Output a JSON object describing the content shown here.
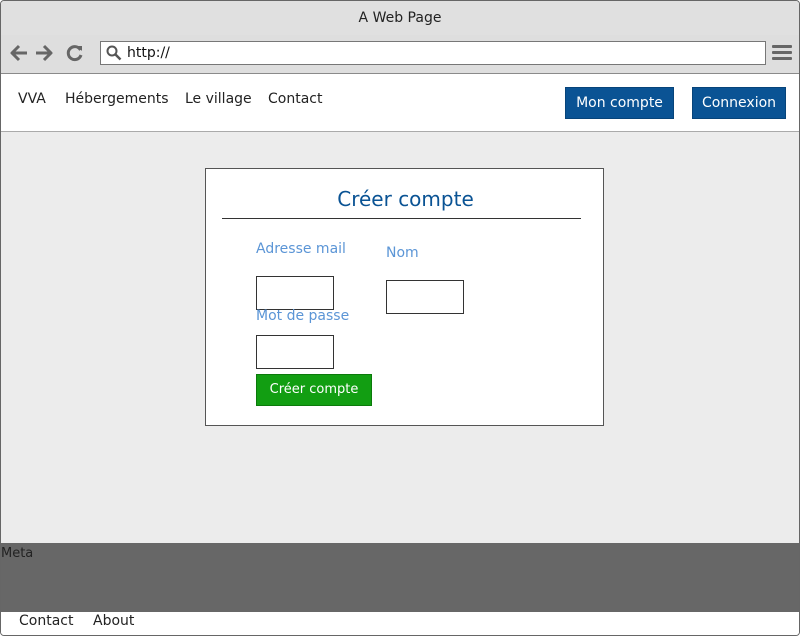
{
  "window": {
    "title": "A Web Page"
  },
  "browser": {
    "url": "http://",
    "icons": {
      "back": "arrow-left-icon",
      "forward": "arrow-right-icon",
      "reload": "reload-icon",
      "search": "search-icon",
      "menu": "hamburger-menu-icon"
    }
  },
  "nav": {
    "links": [
      "VVA",
      "Hébergements",
      "Le village",
      "Contact"
    ],
    "account_label": "Mon compte",
    "login_label": "Connexion"
  },
  "form": {
    "title": "Créer compte",
    "email_label": "Adresse mail",
    "name_label": "Nom",
    "password_label": "Mot de passe",
    "submit_label": "Créer compte"
  },
  "meta": {
    "label": "Meta"
  },
  "footer": {
    "links": [
      "Contact",
      "About"
    ]
  },
  "colors": {
    "primary": "#0a5394",
    "accent_label": "#5b95d6",
    "success": "#129e12",
    "meta_bg": "#676767",
    "page_bg": "#ececec"
  }
}
